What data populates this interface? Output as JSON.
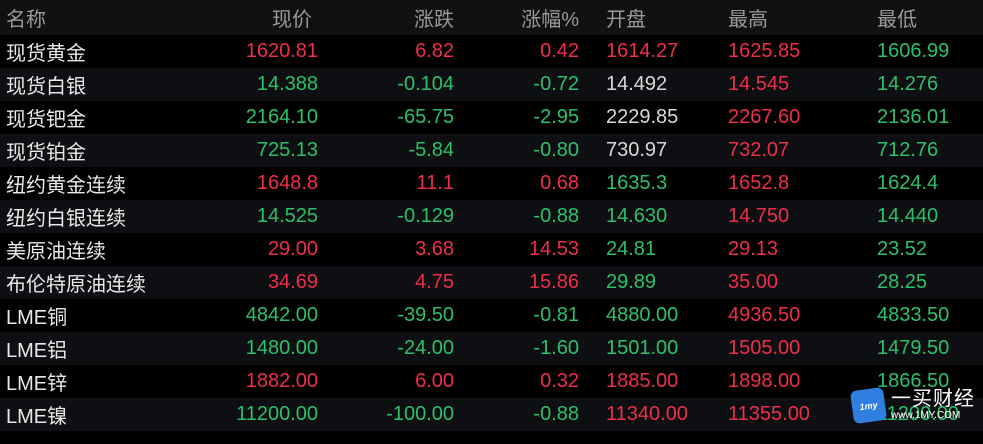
{
  "columns": {
    "name": "名称",
    "price": "现价",
    "change": "涨跌",
    "pct": "涨幅%",
    "open": "开盘",
    "high": "最高",
    "low": "最低"
  },
  "rows": [
    {
      "name": "现货黄金",
      "price": "1620.81",
      "change": "6.82",
      "pct": "0.42",
      "open": "1614.27",
      "high": "1625.85",
      "low": "1606.99",
      "colors": {
        "price": "red",
        "change": "red",
        "pct": "red",
        "open": "red",
        "high": "red",
        "low": "green"
      }
    },
    {
      "name": "现货白银",
      "price": "14.388",
      "change": "-0.104",
      "pct": "-0.72",
      "open": "14.492",
      "high": "14.545",
      "low": "14.276",
      "colors": {
        "price": "green",
        "change": "green",
        "pct": "green",
        "open": "white",
        "high": "red",
        "low": "green"
      }
    },
    {
      "name": "现货钯金",
      "price": "2164.10",
      "change": "-65.75",
      "pct": "-2.95",
      "open": "2229.85",
      "high": "2267.60",
      "low": "2136.01",
      "colors": {
        "price": "green",
        "change": "green",
        "pct": "green",
        "open": "white",
        "high": "red",
        "low": "green"
      }
    },
    {
      "name": "现货铂金",
      "price": "725.13",
      "change": "-5.84",
      "pct": "-0.80",
      "open": "730.97",
      "high": "732.07",
      "low": "712.76",
      "colors": {
        "price": "green",
        "change": "green",
        "pct": "green",
        "open": "white",
        "high": "red",
        "low": "green"
      }
    },
    {
      "name": "纽约黄金连续",
      "price": "1648.8",
      "change": "11.1",
      "pct": "0.68",
      "open": "1635.3",
      "high": "1652.8",
      "low": "1624.4",
      "colors": {
        "price": "red",
        "change": "red",
        "pct": "red",
        "open": "green",
        "high": "red",
        "low": "green"
      }
    },
    {
      "name": "纽约白银连续",
      "price": "14.525",
      "change": "-0.129",
      "pct": "-0.88",
      "open": "14.630",
      "high": "14.750",
      "low": "14.440",
      "colors": {
        "price": "green",
        "change": "green",
        "pct": "green",
        "open": "green",
        "high": "red",
        "low": "green"
      }
    },
    {
      "name": "美原油连续",
      "price": "29.00",
      "change": "3.68",
      "pct": "14.53",
      "open": "24.81",
      "high": "29.13",
      "low": "23.52",
      "colors": {
        "price": "red",
        "change": "red",
        "pct": "red",
        "open": "green",
        "high": "red",
        "low": "green"
      }
    },
    {
      "name": "布伦特原油连续",
      "price": "34.69",
      "change": "4.75",
      "pct": "15.86",
      "open": "29.89",
      "high": "35.00",
      "low": "28.25",
      "colors": {
        "price": "red",
        "change": "red",
        "pct": "red",
        "open": "green",
        "high": "red",
        "low": "green"
      }
    },
    {
      "name": "LME铜",
      "price": "4842.00",
      "change": "-39.50",
      "pct": "-0.81",
      "open": "4880.00",
      "high": "4936.50",
      "low": "4833.50",
      "colors": {
        "price": "green",
        "change": "green",
        "pct": "green",
        "open": "green",
        "high": "red",
        "low": "green"
      }
    },
    {
      "name": "LME铝",
      "price": "1480.00",
      "change": "-24.00",
      "pct": "-1.60",
      "open": "1501.00",
      "high": "1505.00",
      "low": "1479.50",
      "colors": {
        "price": "green",
        "change": "green",
        "pct": "green",
        "open": "green",
        "high": "red",
        "low": "green"
      }
    },
    {
      "name": "LME锌",
      "price": "1882.00",
      "change": "6.00",
      "pct": "0.32",
      "open": "1885.00",
      "high": "1898.00",
      "low": "1866.50",
      "colors": {
        "price": "red",
        "change": "red",
        "pct": "red",
        "open": "red",
        "high": "red",
        "low": "green"
      }
    },
    {
      "name": "LME镍",
      "price": "11200.00",
      "change": "-100.00",
      "pct": "-0.88",
      "open": "11340.00",
      "high": "11355.00",
      "low": "11200.00",
      "colors": {
        "price": "green",
        "change": "green",
        "pct": "green",
        "open": "red",
        "high": "red",
        "low": "green"
      }
    }
  ],
  "watermark": {
    "logo_text": "1my",
    "title": "一买财经",
    "url": "www.1MY.COM"
  },
  "palette": {
    "up": "#ee2e4a",
    "down": "#2dc06a",
    "neutral": "#d8d8d8",
    "header_bg": "#111113",
    "bg": "#000000"
  }
}
